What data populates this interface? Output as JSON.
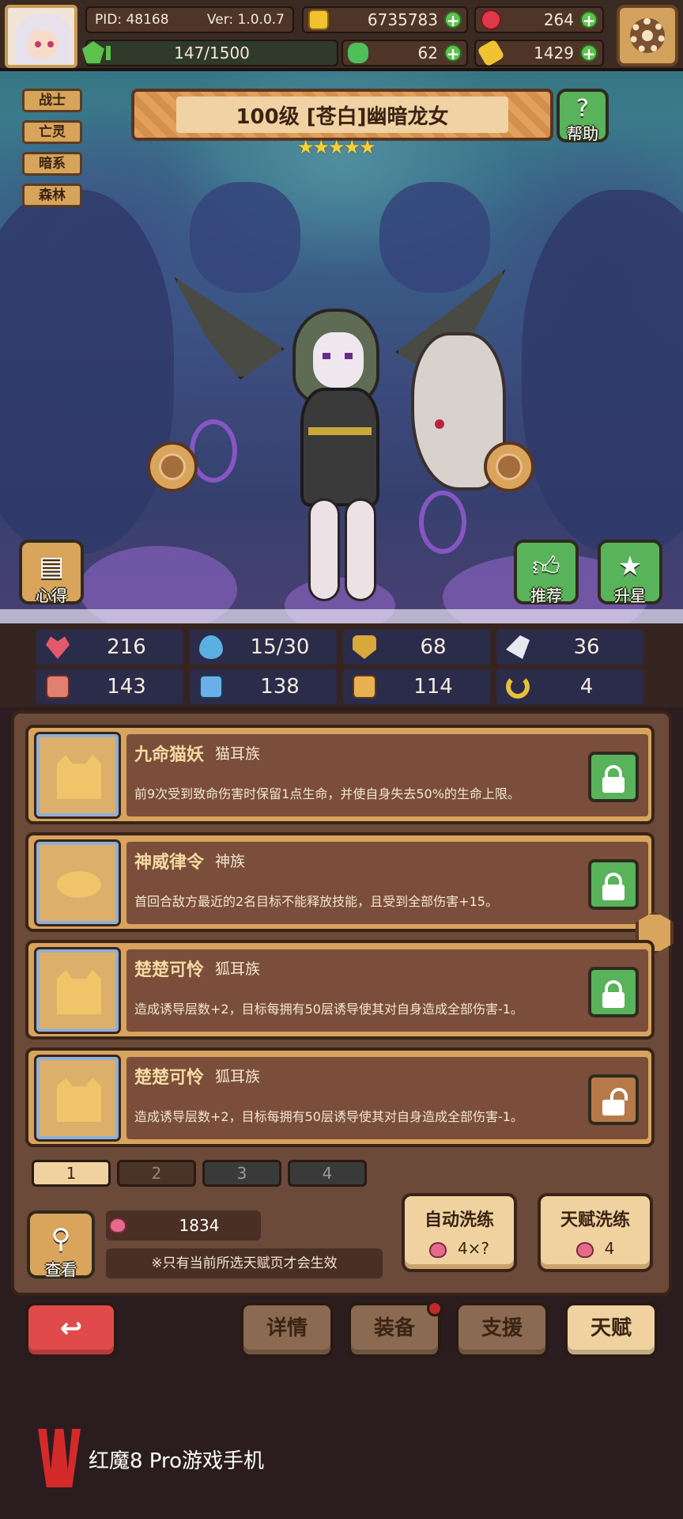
{
  "header": {
    "pid": "PID: 48168",
    "version": "Ver: 1.0.0.7",
    "energy": "147/1500",
    "gold": "6735783",
    "red_gem": "264",
    "clover": "62",
    "ticket": "1429",
    "icons": {
      "settings": "gear-icon",
      "gold": "coin-icon",
      "gem": "ruby-icon",
      "clover": "clover-icon",
      "ticket": "ticket-icon"
    }
  },
  "hero": {
    "tags": [
      "战士",
      "亡灵",
      "暗系",
      "森林"
    ],
    "title": "100级 [苍白]幽暗龙女",
    "stars": 5,
    "help_label": "帮助",
    "notes_label": "心得",
    "recommend_label": "推荐",
    "starup_label": "升星"
  },
  "stats": {
    "row1": [
      "216",
      "15/30",
      "68",
      "36"
    ],
    "row2": [
      "143",
      "138",
      "114",
      "4"
    ]
  },
  "talents": [
    {
      "name": "九命猫妖",
      "group": "猫耳族",
      "desc": "前9次受到致命伤害时保留1点生命，并使自身失去50%的生命上限。",
      "locked": true
    },
    {
      "name": "神威律令",
      "group": "神族",
      "desc": "首回合敌方最近的2名目标不能释放技能，且受到全部伤害+15。",
      "locked": true
    },
    {
      "name": "楚楚可怜",
      "group": "狐耳族",
      "desc": "造成诱导层数+2，目标每拥有50层诱导使其对自身造成全部伤害-1。",
      "locked": true
    },
    {
      "name": "楚楚可怜",
      "group": "狐耳族",
      "desc": "造成诱导层数+2，目标每拥有50层诱导使其对自身造成全部伤害-1。",
      "locked": false
    }
  ],
  "pages": [
    "1",
    "2",
    "3",
    "4"
  ],
  "bottom": {
    "view_label": "查看",
    "currency": "1834",
    "note": "※只有当前所选天赋页才会生效",
    "auto_wash": {
      "title": "自动洗练",
      "cost": "4×?"
    },
    "talent_wash": {
      "title": "天赋洗练",
      "cost": "4"
    }
  },
  "nav": {
    "details": "详情",
    "equipment": "装备",
    "support": "支援",
    "talent": "天赋"
  },
  "watermark": "红魔8 Pro游戏手机",
  "colors": {
    "accent": "#d9a45b",
    "green": "#58b35a",
    "back_red": "#e04a4a",
    "panel": "#6b4a3a"
  }
}
